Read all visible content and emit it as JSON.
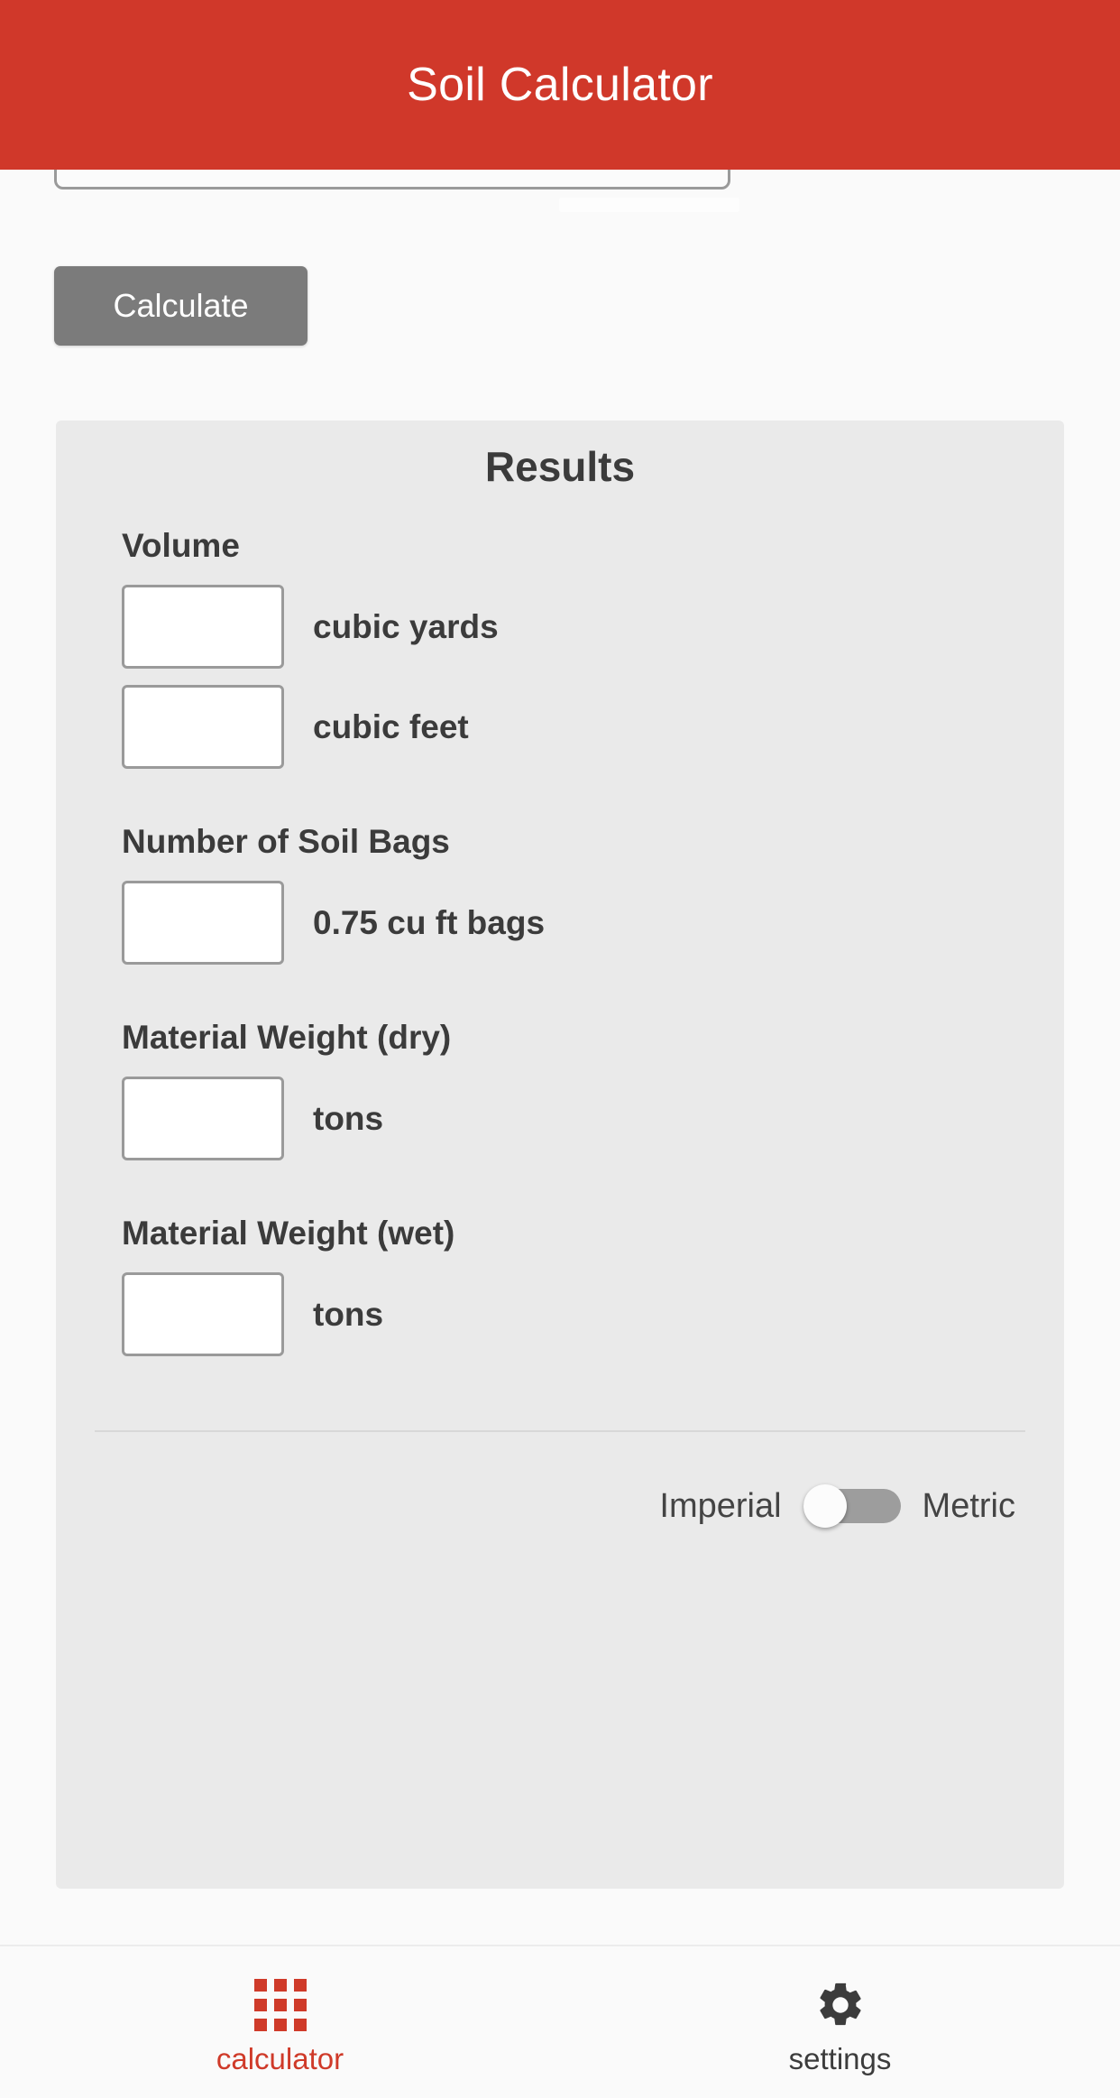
{
  "header": {
    "title": "Soil Calculator",
    "background_color": "#d0382a",
    "text_color": "#ffffff"
  },
  "form": {
    "partial_input_value": "",
    "calculate_label": "Calculate",
    "calculate_color": "#7b7b7b"
  },
  "results": {
    "title": "Results",
    "panel_color": "#eaeaea",
    "sections": [
      {
        "label": "Volume",
        "fields": [
          {
            "value": "",
            "unit": "cubic yards"
          },
          {
            "value": "",
            "unit": "cubic feet"
          }
        ]
      },
      {
        "label": "Number of Soil Bags",
        "fields": [
          {
            "value": "",
            "unit": "0.75 cu ft bags"
          }
        ]
      },
      {
        "label": "Material Weight (dry)",
        "fields": [
          {
            "value": "",
            "unit": "tons"
          }
        ]
      },
      {
        "label": "Material Weight (wet)",
        "fields": [
          {
            "value": "",
            "unit": "tons"
          }
        ]
      }
    ],
    "units": {
      "left_label": "Imperial",
      "right_label": "Metric",
      "selected": "Imperial",
      "toggle_state": "off",
      "track_color": "#9d9d9d",
      "knob_color": "#fcfcfc"
    }
  },
  "bottom_nav": {
    "active_color": "#cf3a29",
    "inactive_color": "#3c3c3c",
    "items": [
      {
        "label": "calculator",
        "icon": "grid-keypad-icon",
        "active": true
      },
      {
        "label": "settings",
        "icon": "gear-icon",
        "active": false
      }
    ]
  }
}
